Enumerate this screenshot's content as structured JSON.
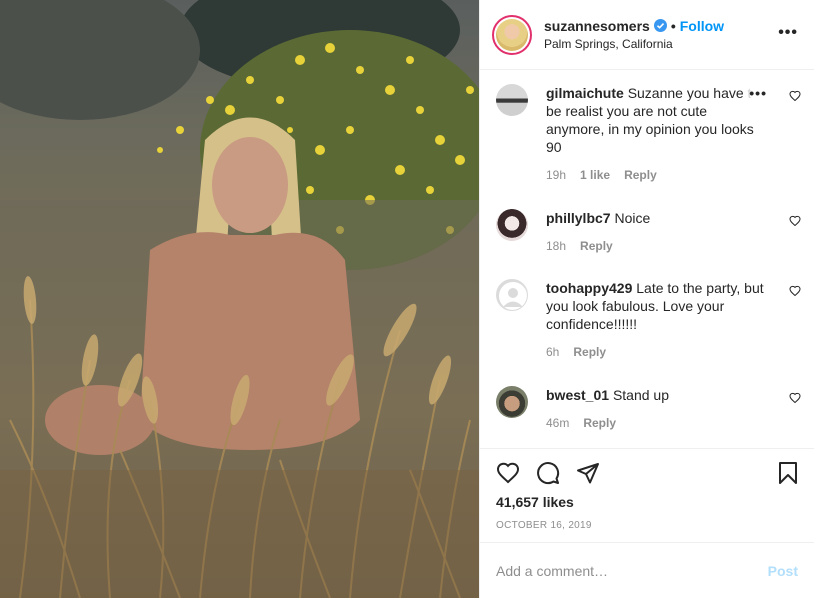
{
  "post": {
    "username": "suzannesomers",
    "follow_label": "Follow",
    "location": "Palm Springs, California",
    "more_label": "•••"
  },
  "comments": [
    {
      "user": "gilmaichute",
      "text": "Suzanne you have to be realist you are not cute anymore, in my opinion you looks 90",
      "time": "19h",
      "likes": "1 like",
      "reply": "Reply",
      "more": "•••"
    },
    {
      "user": "phillylbc7",
      "text": "Noice",
      "time": "18h",
      "reply": "Reply"
    },
    {
      "user": "toohappy429",
      "text": "Late to the party, but you look fabulous. Love your confidence!!!!!!",
      "time": "6h",
      "reply": "Reply"
    },
    {
      "user": "bwest_01",
      "text": "Stand up",
      "time": "46m",
      "reply": "Reply"
    }
  ],
  "actions": {
    "likes": "41,657 likes",
    "date": "OCTOBER 16, 2019"
  },
  "composer": {
    "placeholder": "Add a comment…",
    "post_label": "Post"
  },
  "colors": {
    "accent": "#0095f6",
    "text": "#262626",
    "muted": "#8e8e8e",
    "post_disabled": "#b2dffc"
  }
}
